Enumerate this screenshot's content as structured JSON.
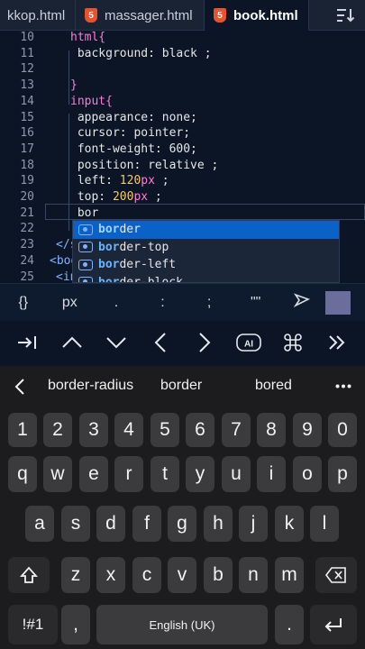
{
  "tabs": [
    {
      "label": "kkop.html",
      "active": false
    },
    {
      "label": "massager.html",
      "active": false
    },
    {
      "label": "book.html",
      "active": true
    }
  ],
  "editor": {
    "lines": [
      {
        "n": "10",
        "text": "html{"
      },
      {
        "n": "11",
        "text": " background: black ;"
      },
      {
        "n": "12",
        "text": ""
      },
      {
        "n": "13",
        "text": "}"
      },
      {
        "n": "14",
        "text": "input{"
      },
      {
        "n": "15",
        "text": " appearance: none;"
      },
      {
        "n": "16",
        "text": " cursor: pointer;"
      },
      {
        "n": "17",
        "text": " font-weight: 600;"
      },
      {
        "n": "18",
        "text": " position: relative ;"
      },
      {
        "n": "19",
        "left": " left: ",
        "num": "120",
        "unit": "px",
        "tail": " ;"
      },
      {
        "n": "20",
        "left": " top: ",
        "num": "200",
        "unit": "px",
        "tail": " ;"
      },
      {
        "n": "21",
        "text": " bor"
      },
      {
        "n": "22",
        "text": ""
      },
      {
        "n": "23",
        "text": "</s"
      },
      {
        "n": "24",
        "text": "<bod"
      },
      {
        "n": "25",
        "text": "<in"
      }
    ],
    "autocomplete": [
      {
        "match": "bor",
        "rest": "der",
        "selected": true
      },
      {
        "match": "bor",
        "rest": "der-top",
        "selected": false
      },
      {
        "match": "bor",
        "rest": "der-left",
        "selected": false
      },
      {
        "match": "bor",
        "rest": "der-block",
        "selected": false
      }
    ]
  },
  "symbol_bar": [
    "{}",
    "px",
    ".",
    ":",
    ";",
    "\"\""
  ],
  "keyboard": {
    "suggestions": [
      "border-radius",
      "border",
      "bored"
    ],
    "row_numbers": [
      "1",
      "2",
      "3",
      "4",
      "5",
      "6",
      "7",
      "8",
      "9",
      "0"
    ],
    "row1": [
      "q",
      "w",
      "e",
      "r",
      "t",
      "y",
      "u",
      "i",
      "o",
      "p"
    ],
    "row2": [
      "a",
      "s",
      "d",
      "f",
      "g",
      "h",
      "j",
      "k",
      "l"
    ],
    "row3": [
      "z",
      "x",
      "c",
      "v",
      "b",
      "n",
      "m"
    ],
    "symbols_key": "!#1",
    "comma_key": ",",
    "space_label": "English (UK)",
    "period_key": "."
  },
  "colors": {
    "editor_bg": "#0b1526",
    "selector": "#ff7ad9",
    "number": "#f3c969",
    "autocomplete_selected": "#0a62c9",
    "keyboard_bg": "#1c1c1e",
    "key_bg": "#3b3b3d"
  },
  "icons": [
    "html5-icon",
    "sort-icon",
    "tab-indent-icon",
    "chevron-up-icon",
    "chevron-down-icon",
    "chevron-left-icon",
    "chevron-right-icon",
    "ai-icon",
    "command-icon",
    "double-chevron-right-icon",
    "send-icon",
    "color-swatch-icon",
    "shift-icon",
    "backspace-icon",
    "enter-icon",
    "more-icon"
  ]
}
